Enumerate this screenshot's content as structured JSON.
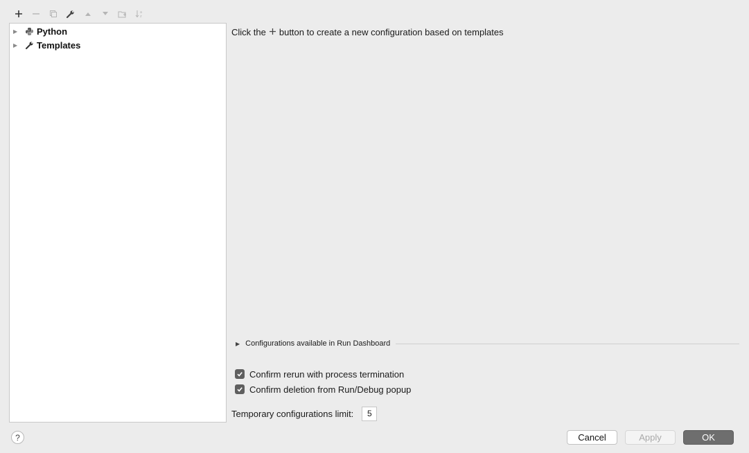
{
  "toolbar": {
    "buttons": [
      {
        "name": "add-icon",
        "glyph": "+"
      },
      {
        "name": "remove-icon",
        "glyph": "−"
      },
      {
        "name": "copy-icon",
        "glyph": "⧉"
      },
      {
        "name": "wrench-icon",
        "glyph": "wrench"
      },
      {
        "name": "move-up-icon",
        "glyph": "▲"
      },
      {
        "name": "move-down-icon",
        "glyph": "▼"
      },
      {
        "name": "folder-icon",
        "glyph": "folder"
      },
      {
        "name": "sort-icon",
        "glyph": "sort"
      }
    ]
  },
  "tree": {
    "items": [
      {
        "label": "Python",
        "icon": "python-icon"
      },
      {
        "label": "Templates",
        "icon": "wrench-icon"
      }
    ]
  },
  "main": {
    "hint_prefix": "Click the",
    "hint_suffix": "button to create a new configuration based on templates",
    "dashboard_label": "Configurations available in Run Dashboard",
    "confirm_rerun_label": "Confirm rerun with process termination",
    "confirm_rerun_checked": true,
    "confirm_deletion_label": "Confirm deletion from Run/Debug popup",
    "confirm_deletion_checked": true,
    "temp_limit_label": "Temporary configurations limit:",
    "temp_limit_value": "5"
  },
  "footer": {
    "help_label": "?",
    "cancel_label": "Cancel",
    "apply_label": "Apply",
    "ok_label": "OK"
  },
  "colors": {
    "background": "#ececec",
    "panel": "#ffffff",
    "ok_button": "#6e6e6e",
    "checkbox": "#5f5f5f"
  }
}
